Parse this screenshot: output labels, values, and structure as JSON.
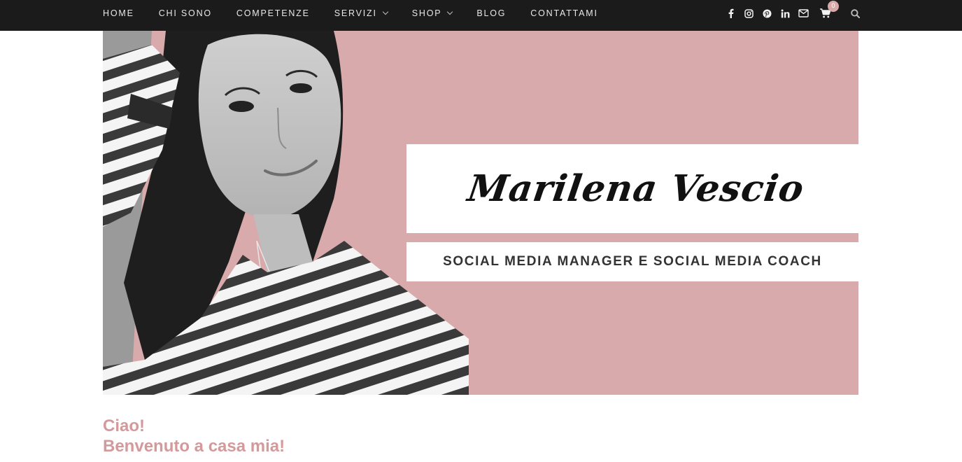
{
  "nav": {
    "items": [
      {
        "label": "HOME",
        "dropdown": false
      },
      {
        "label": "CHI SONO",
        "dropdown": false
      },
      {
        "label": "COMPETENZE",
        "dropdown": false
      },
      {
        "label": "SERVIZI",
        "dropdown": true
      },
      {
        "label": "SHOP",
        "dropdown": true
      },
      {
        "label": "BLOG",
        "dropdown": false
      },
      {
        "label": "CONTATTAMI",
        "dropdown": false
      }
    ]
  },
  "social_icons": [
    "facebook-icon",
    "instagram-icon",
    "pinterest-icon",
    "linkedin-icon",
    "envelope-icon"
  ],
  "cart": {
    "icon": "shopping-cart-icon",
    "count": "0"
  },
  "search": {
    "icon": "search-icon"
  },
  "hero": {
    "name": "Marilena Vescio",
    "subtitle": "SOCIAL MEDIA MANAGER E SOCIAL MEDIA COACH"
  },
  "greeting": {
    "line1": "Ciao!",
    "line2": "Benvenuto a casa mia!"
  },
  "colors": {
    "topbar": "#1b1b1b",
    "accent_pink": "#d8aaab",
    "greeting_pink": "#d49a9b",
    "badge": "#d9a8a9"
  }
}
